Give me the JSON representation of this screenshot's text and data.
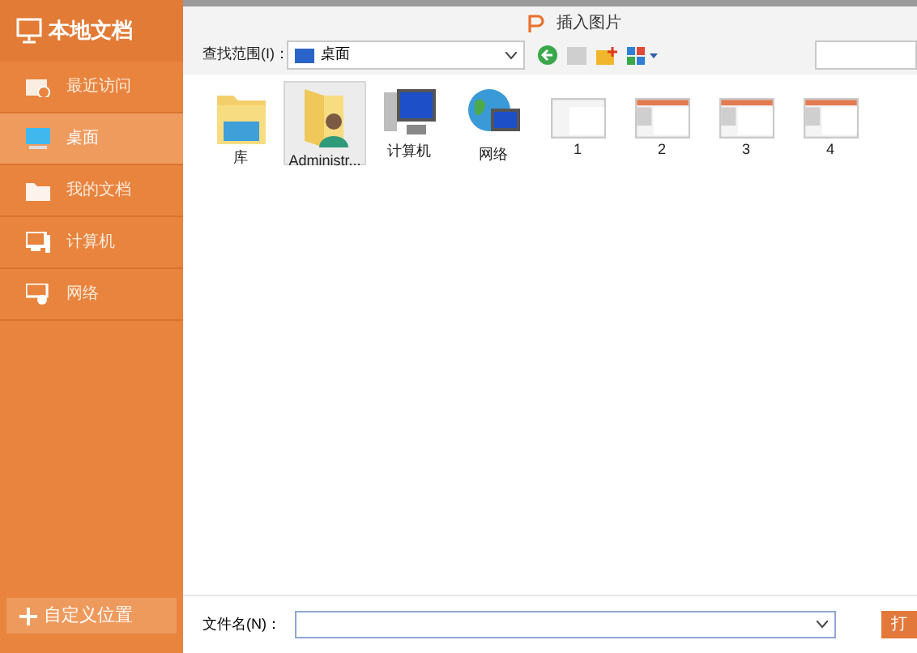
{
  "sidebar": {
    "title": "本地文档",
    "items": [
      {
        "label": "最近访问",
        "kind": "recent",
        "selected": false
      },
      {
        "label": "桌面",
        "kind": "desktop",
        "selected": true
      },
      {
        "label": "我的文档",
        "kind": "docs",
        "selected": false
      },
      {
        "label": "计算机",
        "kind": "computer",
        "selected": false
      },
      {
        "label": "网络",
        "kind": "network",
        "selected": false
      }
    ],
    "add_button": "自定义位置"
  },
  "dialog": {
    "title": "插入图片",
    "look_in_label": "查找范围(I)：",
    "look_in_value": "桌面"
  },
  "files": [
    {
      "name": "库",
      "kind": "library",
      "selected": false
    },
    {
      "name": "Administr...",
      "kind": "user",
      "selected": true
    },
    {
      "name": "计算机",
      "kind": "computer",
      "selected": false
    },
    {
      "name": "网络",
      "kind": "network",
      "selected": false
    },
    {
      "name": "1",
      "kind": "slide",
      "selected": false
    },
    {
      "name": "2",
      "kind": "slide",
      "selected": false
    },
    {
      "name": "3",
      "kind": "slide",
      "selected": false
    },
    {
      "name": "4",
      "kind": "slide",
      "selected": false
    }
  ],
  "filename_label": "文件名(N)：",
  "open_button": "打"
}
